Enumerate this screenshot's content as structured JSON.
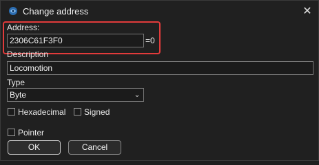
{
  "window": {
    "title": "Change address",
    "close_icon": "close-icon",
    "app_icon": "cheat-engine-icon"
  },
  "address": {
    "label": "Address:",
    "value": "2306C61F3F0",
    "result": "=0"
  },
  "description": {
    "label": "Description",
    "value": "Locomotion"
  },
  "type": {
    "label": "Type",
    "selected": "Byte"
  },
  "options": {
    "hexadecimal_label": "Hexadecimal",
    "signed_label": "Signed",
    "pointer_label": "Pointer",
    "hexadecimal_checked": false,
    "signed_checked": false,
    "pointer_checked": false
  },
  "buttons": {
    "ok_label": "OK",
    "cancel_label": "Cancel"
  },
  "colors": {
    "highlight": "#e23b3b",
    "background": "#202020"
  }
}
